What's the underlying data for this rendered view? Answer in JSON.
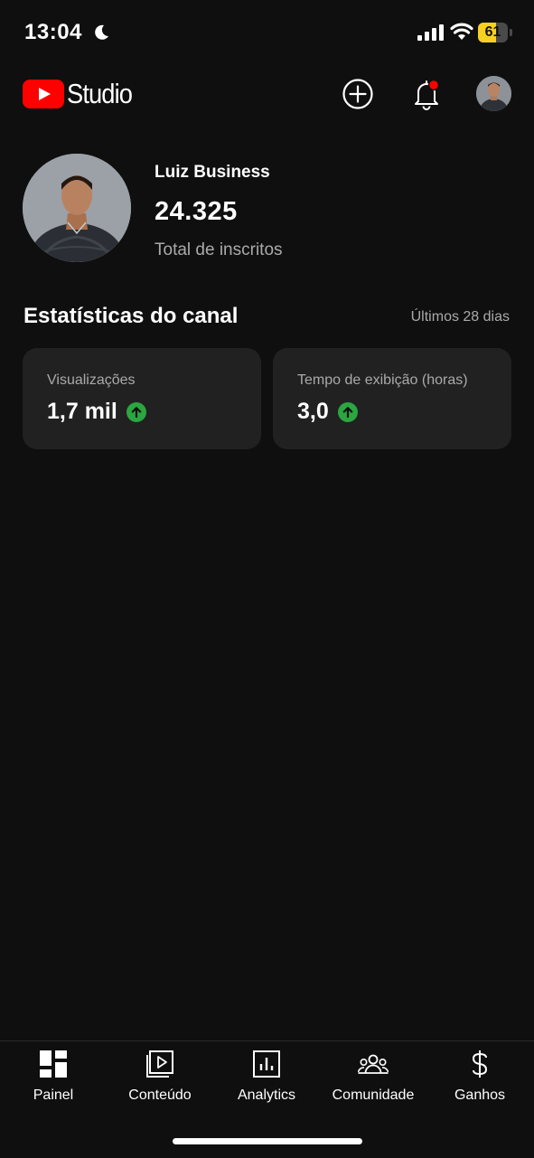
{
  "status_bar": {
    "time": "13:04",
    "battery_level": "61",
    "battery_fraction": 0.61,
    "icons": [
      "moon-icon",
      "signal-icon",
      "wifi-icon",
      "battery-icon"
    ]
  },
  "header": {
    "app_name": "Studio",
    "icons": [
      "youtube-logo-icon",
      "create-plus-icon",
      "bell-icon",
      "account-avatar"
    ],
    "colors": {
      "brand_red": "#ff0000",
      "notification_dot": "#ff0000"
    }
  },
  "channel": {
    "name": "Luiz Business",
    "subscriber_count": "24.325",
    "subscriber_label": "Total de inscritos"
  },
  "stats": {
    "heading": "Estatísticas do canal",
    "period": "Últimos 28 dias",
    "cards": [
      {
        "label": "Visualizações",
        "value": "1,7 mil",
        "trend": "up",
        "trend_icon": "arrow-up-icon"
      },
      {
        "label": "Tempo de exibição (horas)",
        "value": "3,0",
        "trend": "up",
        "trend_icon": "arrow-up-icon"
      }
    ],
    "colors": {
      "trend_up": "#2ba640",
      "card_bg": "#212121"
    }
  },
  "bottom_nav": {
    "items": [
      {
        "label": "Painel",
        "icon": "dashboard-icon"
      },
      {
        "label": "Conteúdo",
        "icon": "content-icon"
      },
      {
        "label": "Analytics",
        "icon": "analytics-icon"
      },
      {
        "label": "Comunidade",
        "icon": "community-icon"
      },
      {
        "label": "Ganhos",
        "icon": "earn-icon"
      }
    ]
  }
}
